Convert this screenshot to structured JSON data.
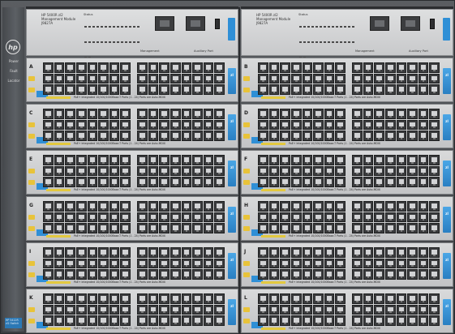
{
  "device": {
    "left_panel": {
      "logo": "hp",
      "led_labels": [
        "Power",
        "Fault",
        "Locator"
      ],
      "badge": "HP 5412R zl2 Switch"
    },
    "management_modules": [
      {
        "title_line1": "HP 5400R zl2",
        "title_line2": "Management Module",
        "title_line3": "J9827A",
        "status_label": "Status",
        "mgmt_label": "Management",
        "aux_label": "Auxiliary Port",
        "tab_label": "zl"
      },
      {
        "title_line1": "HP 5400R zl2",
        "title_line2": "Management Module",
        "title_line3": "J9827A",
        "status_label": "Status",
        "mgmt_label": "Management",
        "aux_label": "Auxiliary Port",
        "tab_label": "zl"
      }
    ],
    "slots": [
      {
        "letter": "A",
        "strip_text": "PoE+ Integrated 10/100/1000Base-T Ports (1 - 24)   Ports are Auto-MDIX",
        "tab": "zl"
      },
      {
        "letter": "B",
        "strip_text": "PoE+ Integrated 10/100/1000Base-T Ports (1 - 24)   Ports are Auto-MDIX",
        "tab": "zl"
      },
      {
        "letter": "C",
        "strip_text": "PoE+ Integrated 10/100/1000Base-T Ports (1 - 24)   Ports are Auto-MDIX",
        "tab": "zl"
      },
      {
        "letter": "D",
        "strip_text": "PoE+ Integrated 10/100/1000Base-T Ports (1 - 24)   Ports are Auto-MDIX",
        "tab": "zl"
      },
      {
        "letter": "E",
        "strip_text": "PoE+ Integrated 10/100/1000Base-T Ports (1 - 24)   Ports are Auto-MDIX",
        "tab": "zl"
      },
      {
        "letter": "F",
        "strip_text": "PoE+ Integrated 10/100/1000Base-T Ports (1 - 24)   Ports are Auto-MDIX",
        "tab": "zl"
      },
      {
        "letter": "G",
        "strip_text": "PoE+ Integrated 10/100/1000Base-T Ports (1 - 24)   Ports are Auto-MDIX",
        "tab": "zl"
      },
      {
        "letter": "H",
        "strip_text": "PoE+ Integrated 10/100/1000Base-T Ports (1 - 24)   Ports are Auto-MDIX",
        "tab": "zl"
      },
      {
        "letter": "I",
        "strip_text": "PoE+ Integrated 10/100/1000Base-T Ports (1 - 24)   Ports are Auto-MDIX",
        "tab": "zl"
      },
      {
        "letter": "J",
        "strip_text": "PoE+ Integrated 10/100/1000Base-T Ports (1 - 24)   Ports are Auto-MDIX",
        "tab": "zl"
      },
      {
        "letter": "K",
        "strip_text": "PoE+ Integrated 10/100/1000Base-T Ports (1 - 24)   Ports are Auto-MDIX",
        "tab": "zl"
      },
      {
        "letter": "L",
        "strip_text": "PoE+ Integrated 10/100/1000Base-T Ports (1 - 24)   Ports are Auto-MDIX",
        "tab": "zl"
      }
    ],
    "colors": {
      "chassis": "#45484c",
      "module_face": "#d4d5d7",
      "accent_blue": "#2f8fd6",
      "label_yellow": "#e3c93f"
    }
  }
}
